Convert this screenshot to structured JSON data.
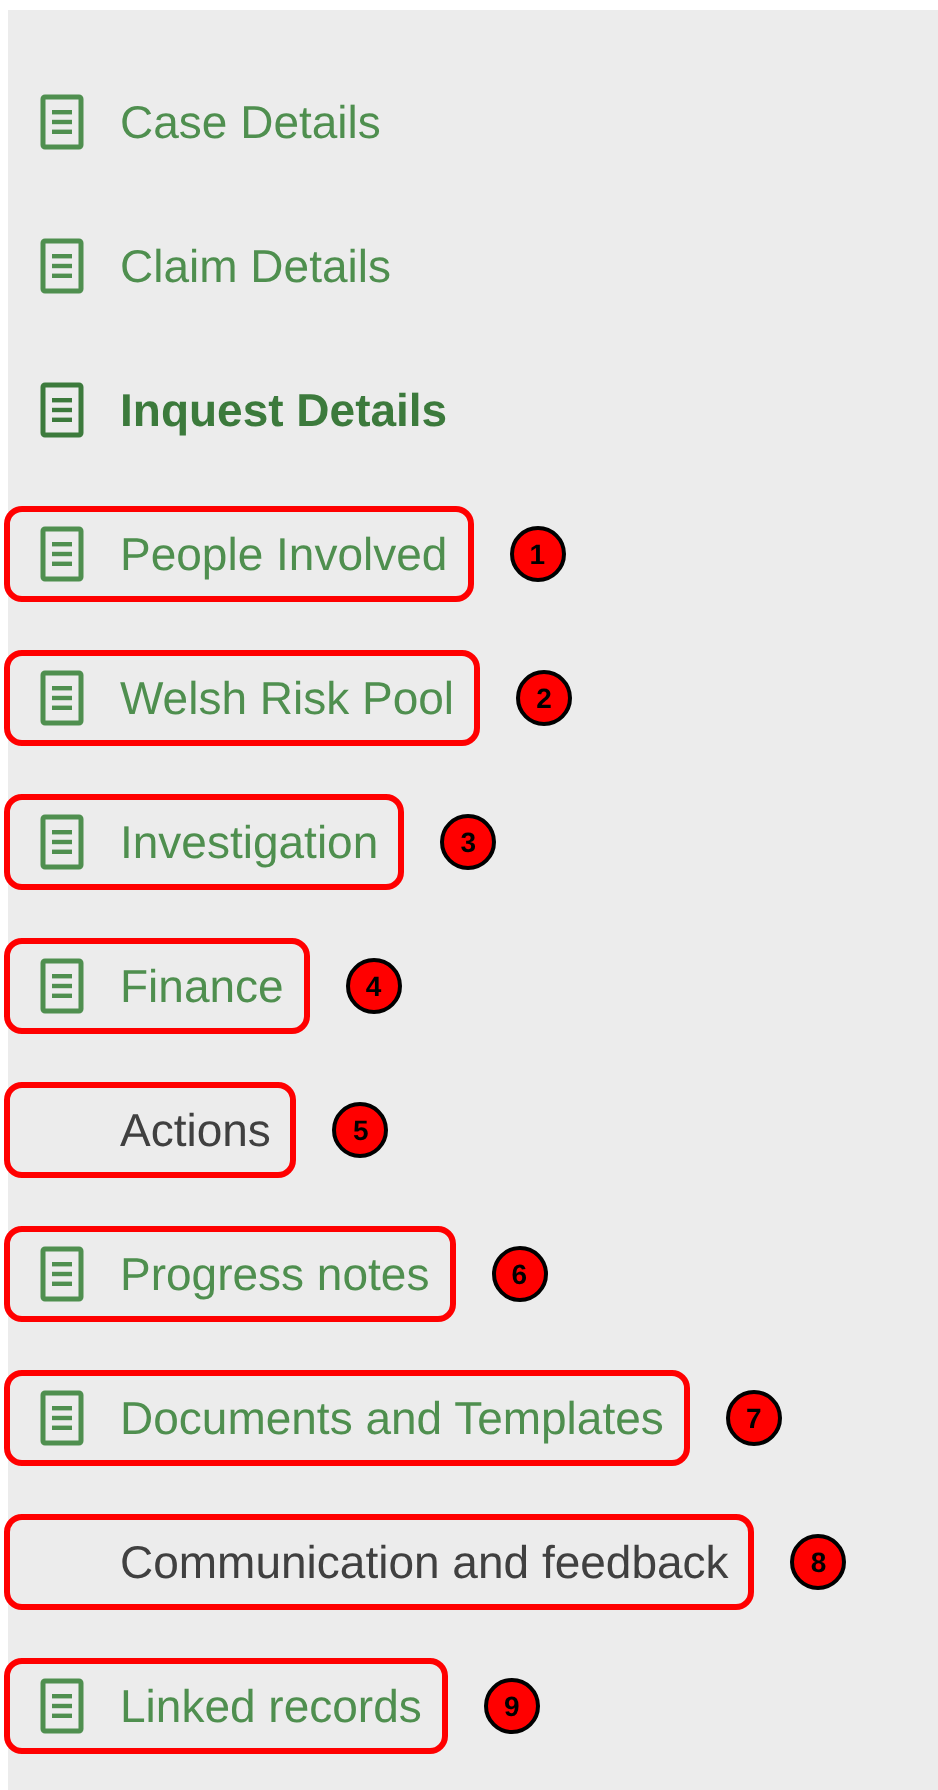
{
  "navigation": {
    "items": [
      {
        "label": "Case Details",
        "kind": "link"
      },
      {
        "label": "Claim Details",
        "kind": "link"
      },
      {
        "label": "Inquest Details",
        "kind": "current"
      },
      {
        "label": "People Involved",
        "kind": "link",
        "callout": "1"
      },
      {
        "label": "Welsh Risk Pool",
        "kind": "link",
        "callout": "2"
      },
      {
        "label": "Investigation",
        "kind": "link",
        "callout": "3"
      },
      {
        "label": "Finance",
        "kind": "link",
        "callout": "4"
      },
      {
        "label": "Actions",
        "kind": "plain",
        "callout": "5"
      },
      {
        "label": "Progress notes",
        "kind": "link",
        "callout": "6"
      },
      {
        "label": "Documents and Templates",
        "kind": "link",
        "callout": "7"
      },
      {
        "label": "Communication and feedback",
        "kind": "plain",
        "callout": "8"
      },
      {
        "label": "Linked records",
        "kind": "link",
        "callout": "9"
      }
    ]
  }
}
